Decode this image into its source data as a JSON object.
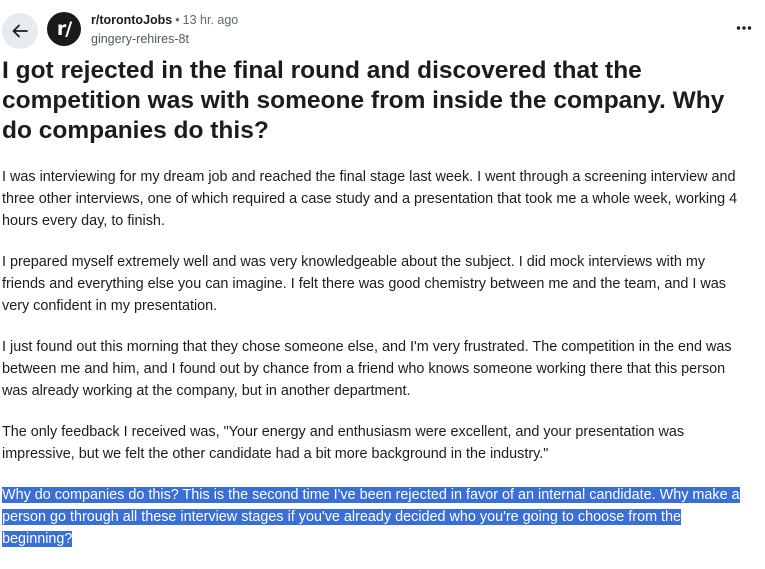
{
  "header": {
    "subreddit": "r/torontoJobs",
    "separator": "•",
    "time_ago": "13 hr. ago",
    "author": "gingery-rehires-8t",
    "avatar_text": "r/",
    "back_icon": "arrow-left-icon",
    "more_icon": "ellipsis-icon"
  },
  "post": {
    "title": "I got rejected in the final round and discovered that the competition was with someone from inside the company. Why do companies do this?",
    "paragraphs": [
      "I was interviewing for my dream job and reached the final stage last week. I went through a screening interview and three other interviews, one of which required a case study and a presentation that took me a whole week, working 4 hours every day, to finish.",
      "I prepared myself extremely well and was very knowledgeable about the subject. I did mock interviews with my friends and everything else you can imagine. I felt there was good chemistry between me and the team, and I was very confident in my presentation.",
      "I just found out this morning that they chose someone else, and I'm very frustrated. The competition in the end was between me and him, and I found out by chance from a friend who knows someone working there that this person was already working at the company, but in another department.",
      "The only feedback I received was, \"Your energy and enthusiasm were excellent, and your presentation was impressive, but we felt the other candidate had a bit more background in the industry.\"",
      "Why do companies do this? This is the second time I've been rejected in favor of an internal candidate. Why make a person go through all these interview stages if you've already decided who you're going to choose from the beginning?"
    ]
  },
  "colors": {
    "selection": "#3a6fd8",
    "back_button_bg": "#e5ebee",
    "avatar_bg": "#1a1a1b"
  }
}
